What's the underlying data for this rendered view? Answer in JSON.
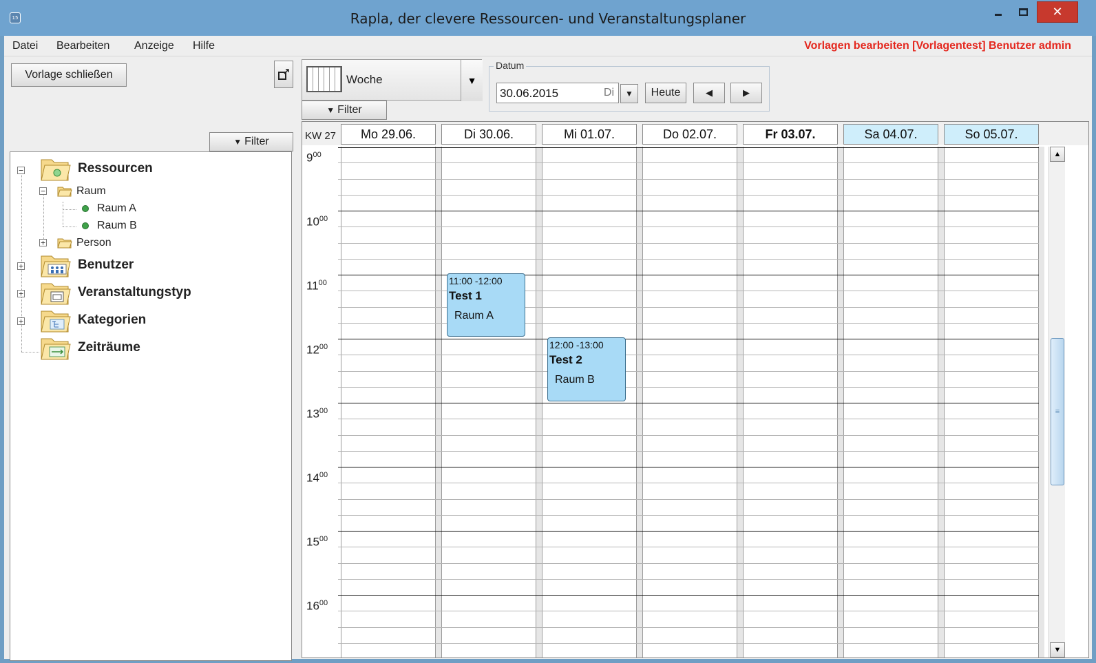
{
  "window": {
    "title": "Rapla, der clevere Ressourcen- und Veranstaltungsplaner",
    "app_icon_text": "15",
    "close_glyph": "✕"
  },
  "menubar": {
    "items": [
      "Datei",
      "Bearbeiten",
      "Anzeige",
      "Hilfe"
    ],
    "status_text": "Vorlagen bearbeiten [Vorlagentest] Benutzer admin",
    "status_color": "#e4271e"
  },
  "left": {
    "close_template_label": "Vorlage schließen",
    "filter_label": "Filter",
    "tree": {
      "ressourcen": "Ressourcen",
      "raum": "Raum",
      "raum_a": "Raum A",
      "raum_b": "Raum B",
      "person": "Person",
      "benutzer": "Benutzer",
      "veranstaltungstyp": "Veranstaltungstyp",
      "kategorien": "Kategorien",
      "zeitraeume": "Zeiträume"
    }
  },
  "toolbar": {
    "view_label": "Woche",
    "filter_label": "Filter",
    "datum_caption": "Datum",
    "date_value": "30.06.2015",
    "date_weekday": "Di",
    "today_label": "Heute"
  },
  "calendar": {
    "week_label": "KW 27",
    "days": [
      {
        "label": "Mo 29.06.",
        "weekend": false,
        "bold": false
      },
      {
        "label": "Di 30.06.",
        "weekend": false,
        "bold": false
      },
      {
        "label": "Mi 01.07.",
        "weekend": false,
        "bold": false
      },
      {
        "label": "Do 02.07.",
        "weekend": false,
        "bold": false
      },
      {
        "label": "Fr 03.07.",
        "weekend": false,
        "bold": true
      },
      {
        "label": "Sa 04.07.",
        "weekend": true,
        "bold": false
      },
      {
        "label": "So 05.07.",
        "weekend": true,
        "bold": false
      }
    ],
    "hours": [
      "9",
      "10",
      "11",
      "12",
      "13",
      "14",
      "15",
      "16"
    ],
    "hour_minutes": "00",
    "events": [
      {
        "day": "Di 30.06.",
        "time": "11:00 -12:00",
        "title": "Test 1",
        "resource": "Raum A"
      },
      {
        "day": "Mi 01.07.",
        "time": "12:00 -13:00",
        "title": "Test 2",
        "resource": "Raum B"
      }
    ],
    "colors": {
      "event": "#a8daf6",
      "weekend_header": "#cfeefb"
    }
  }
}
